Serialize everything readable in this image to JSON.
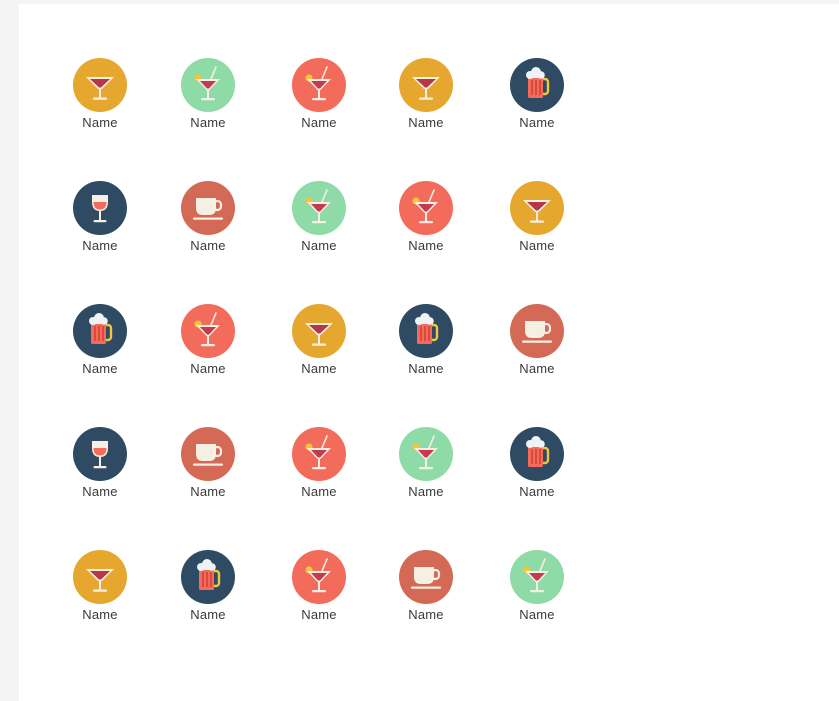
{
  "colors": {
    "gold": "#e6a72e",
    "mint": "#8fdba8",
    "coral": "#f36b5b",
    "navy": "#2f4a63",
    "terracotta": "#d46a55"
  },
  "rows": [
    [
      {
        "icon": "martini-icon",
        "color": "gold",
        "label": "Name"
      },
      {
        "icon": "cocktail-icon",
        "color": "mint",
        "label": "Name"
      },
      {
        "icon": "cocktail-icon",
        "color": "coral",
        "label": "Name"
      },
      {
        "icon": "martini-icon",
        "color": "gold",
        "label": "Name"
      },
      {
        "icon": "beer-mug-icon",
        "color": "navy",
        "label": "Name"
      }
    ],
    [
      {
        "icon": "wine-glass-icon",
        "color": "navy",
        "label": "Name"
      },
      {
        "icon": "coffee-cup-icon",
        "color": "terracotta",
        "label": "Name"
      },
      {
        "icon": "cocktail-icon",
        "color": "mint",
        "label": "Name"
      },
      {
        "icon": "cocktail-icon",
        "color": "coral",
        "label": "Name"
      },
      {
        "icon": "martini-icon",
        "color": "gold",
        "label": "Name"
      }
    ],
    [
      {
        "icon": "beer-mug-icon",
        "color": "navy",
        "label": "Name"
      },
      {
        "icon": "cocktail-icon",
        "color": "coral",
        "label": "Name"
      },
      {
        "icon": "martini-icon",
        "color": "gold",
        "label": "Name"
      },
      {
        "icon": "beer-mug-icon",
        "color": "navy",
        "label": "Name"
      },
      {
        "icon": "coffee-cup-icon",
        "color": "terracotta",
        "label": "Name"
      }
    ],
    [
      {
        "icon": "wine-glass-icon",
        "color": "navy",
        "label": "Name"
      },
      {
        "icon": "coffee-cup-icon",
        "color": "terracotta",
        "label": "Name"
      },
      {
        "icon": "cocktail-icon",
        "color": "coral",
        "label": "Name"
      },
      {
        "icon": "cocktail-icon",
        "color": "mint",
        "label": "Name"
      },
      {
        "icon": "beer-mug-icon",
        "color": "navy",
        "label": "Name"
      }
    ],
    [
      {
        "icon": "martini-icon",
        "color": "gold",
        "label": "Name"
      },
      {
        "icon": "beer-mug-icon",
        "color": "navy",
        "label": "Name"
      },
      {
        "icon": "cocktail-icon",
        "color": "coral",
        "label": "Name"
      },
      {
        "icon": "coffee-cup-icon",
        "color": "terracotta",
        "label": "Name"
      },
      {
        "icon": "cocktail-icon",
        "color": "mint",
        "label": "Name"
      }
    ]
  ]
}
